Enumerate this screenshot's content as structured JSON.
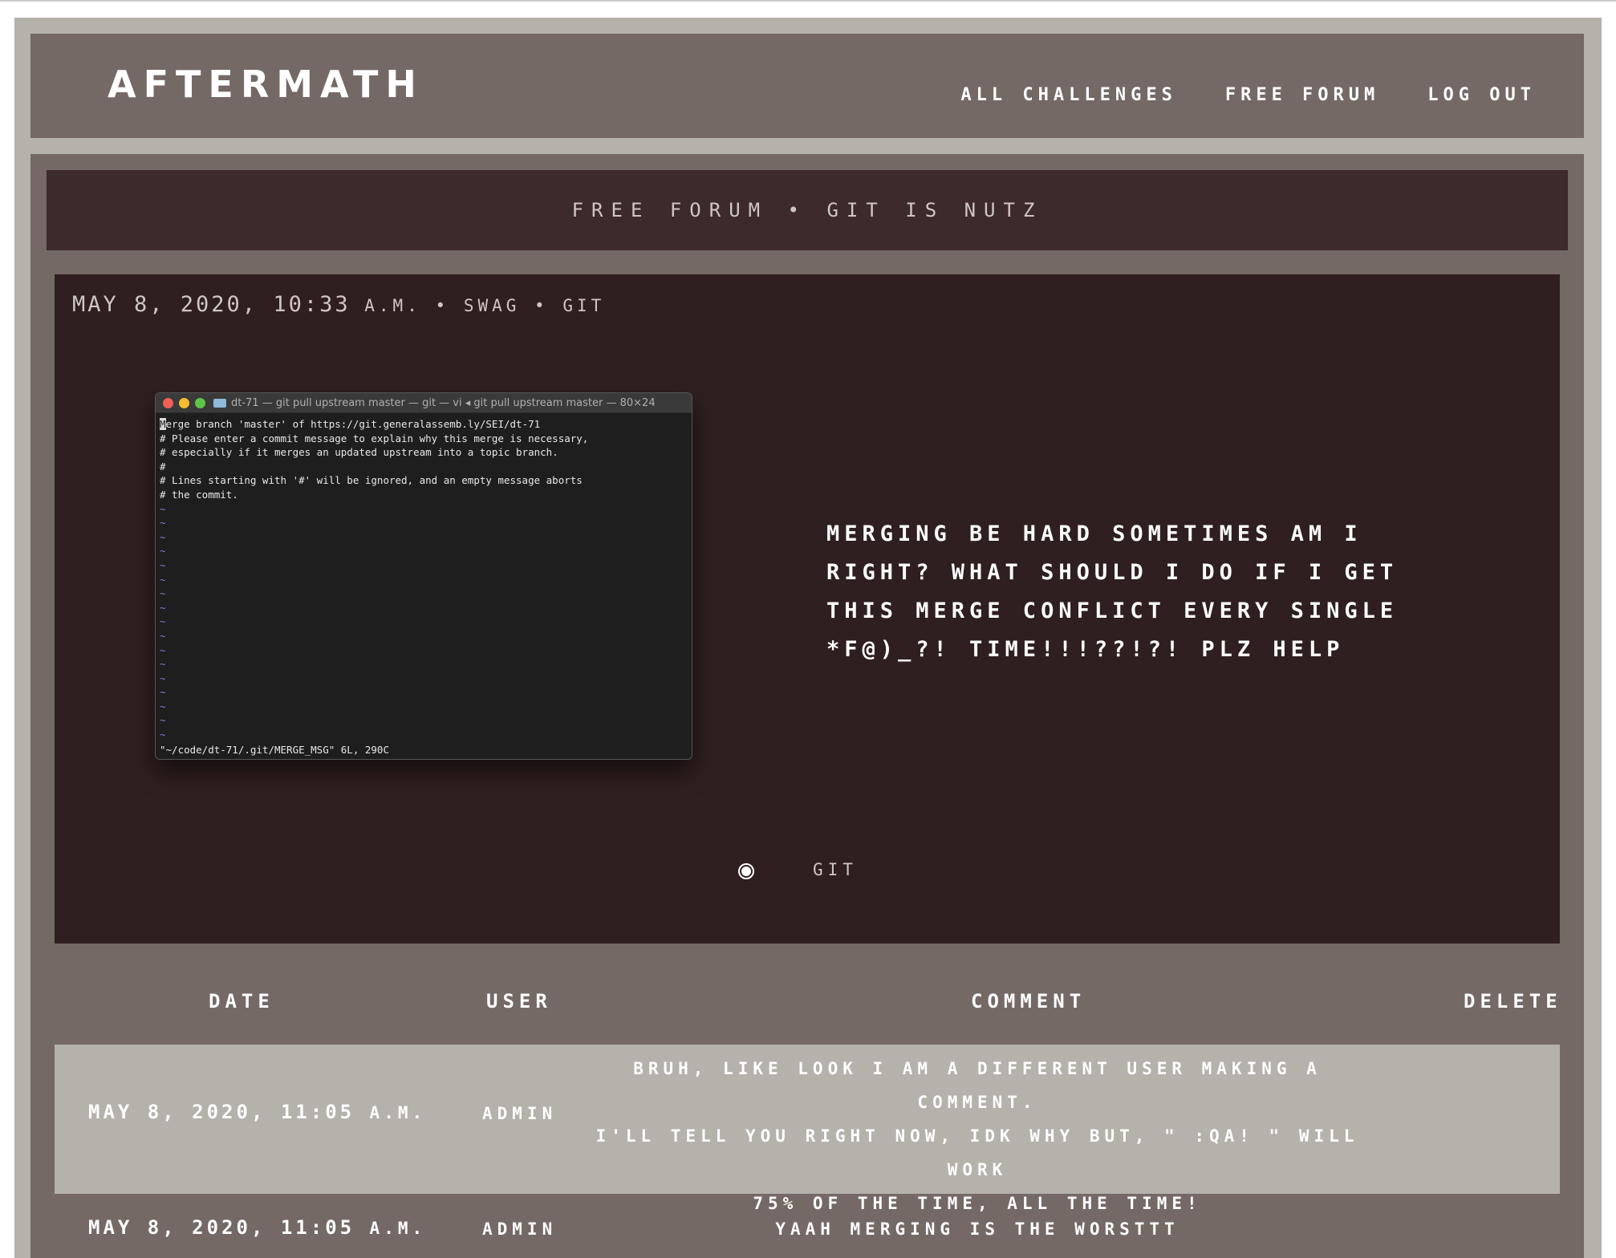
{
  "header": {
    "brand": "AFTERMATH",
    "nav": [
      "ALL CHALLENGES",
      "FREE FORUM",
      "LOG OUT"
    ]
  },
  "thread": {
    "breadcrumb": "FREE FORUM • GIT IS NUTZ"
  },
  "post": {
    "date": "MAY 8, 2020, 10:33",
    "ampm": "A.M.",
    "sep1": "•",
    "author": "SWAG",
    "sep2": "•",
    "category": "GIT",
    "body": "MERGING BE HARD SOMETIMES AM I RIGHT? WHAT SHOULD I DO IF I GET THIS MERGE CONFLICT EVERY SINGLE *F@)_?! TIME!!!??!?! PLZ HELP",
    "tag": "GIT"
  },
  "terminal": {
    "title": "dt-71 — git pull upstream master — git — vi ◂ git pull upstream master — 80×24",
    "first_char": "M",
    "first_rest": "erge branch 'master' of https://git.generalassemb.ly/SEI/dt-71",
    "lines": [
      "# Please enter a commit message to explain why this merge is necessary,",
      "# especially if it merges an updated upstream into a topic branch.",
      "#",
      "# Lines starting with '#' will be ignored, and an empty message aborts",
      "# the commit."
    ],
    "tilde": "~",
    "status": "\"~/code/dt-71/.git/MERGE_MSG\" 6L, 290C"
  },
  "comments_table": {
    "headers": [
      "DATE",
      "USER",
      "COMMENT",
      "DELETE"
    ],
    "rows": [
      {
        "date": "MAY 8, 2020, 11:05",
        "ampm": "A.M.",
        "user": "ADMIN",
        "comment_lines": [
          "BRUH, LIKE LOOK I AM A DIFFERENT USER MAKING A COMMENT.",
          "I'LL TELL YOU RIGHT NOW, IDK WHY BUT, \" :QA! \" WILL WORK",
          "75% OF THE TIME, ALL THE TIME!"
        ]
      },
      {
        "date": "MAY 8, 2020, 11:05",
        "ampm": "A.M.",
        "user": "ADMIN",
        "comment_lines": [
          "YAAH MERGING IS THE WORSTTT"
        ]
      }
    ]
  },
  "colors": {
    "frame": "#b5b1ab",
    "header_bg": "#746965",
    "thread_bar": "#3d2a2b",
    "post_bg": "#2f1f20",
    "row_highlight": "#b5b1ab"
  }
}
